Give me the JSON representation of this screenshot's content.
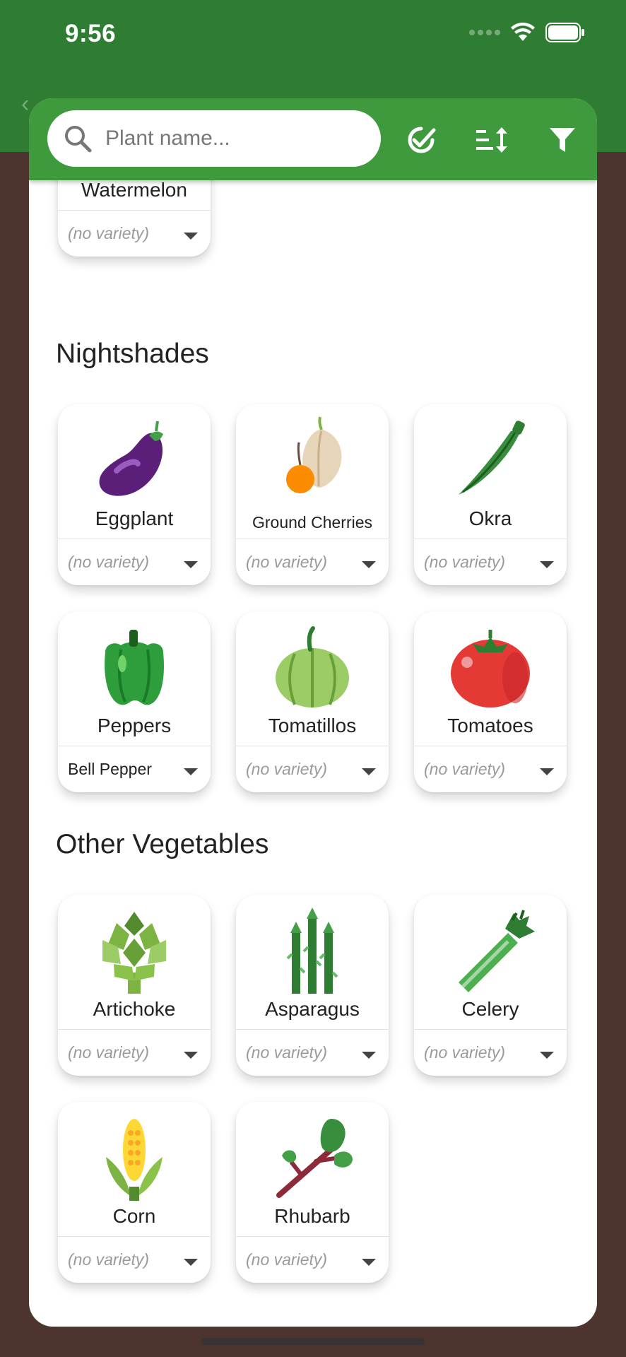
{
  "status": {
    "time": "9:56"
  },
  "search": {
    "placeholder": "Plant name..."
  },
  "header": {
    "icons": [
      "search-icon",
      "check-all-icon",
      "sort-icon",
      "filter-icon"
    ]
  },
  "sections": [
    {
      "title": "Nightshades"
    },
    {
      "title": "Other Vegetables"
    }
  ],
  "plants": [
    {
      "name": "Watermelon",
      "variety": "(no variety)"
    },
    {
      "name": "Eggplant",
      "variety": "(no variety)"
    },
    {
      "name": "Ground Cherries",
      "variety": "(no variety)"
    },
    {
      "name": "Okra",
      "variety": "(no variety)"
    },
    {
      "name": "Peppers",
      "variety": "Bell Pepper"
    },
    {
      "name": "Tomatillos",
      "variety": "(no variety)"
    },
    {
      "name": "Tomatoes",
      "variety": "(no variety)"
    },
    {
      "name": "Artichoke",
      "variety": "(no variety)"
    },
    {
      "name": "Asparagus",
      "variety": "(no variety)"
    },
    {
      "name": "Celery",
      "variety": "(no variety)"
    },
    {
      "name": "Corn",
      "variety": "(no variety)"
    },
    {
      "name": "Rhubarb",
      "variety": "(no variety)"
    }
  ],
  "colors": {
    "appbar": "#2e7d32",
    "header": "#3f9a3e",
    "background": "#4e342e"
  }
}
